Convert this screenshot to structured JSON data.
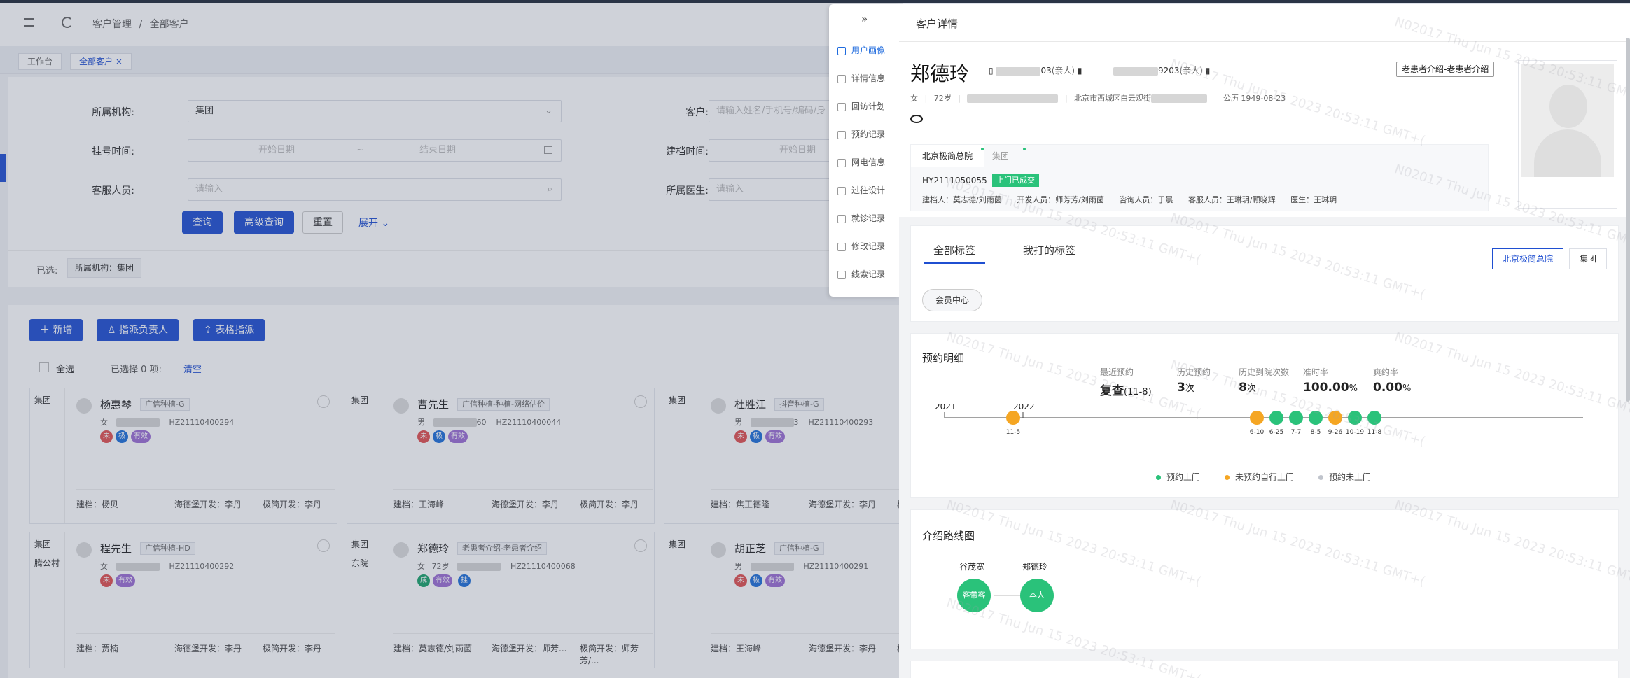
{
  "topbar": {
    "breadcrumb_1": "客户管理",
    "breadcrumb_sep": "/",
    "breadcrumb_2": "全部客户"
  },
  "tabs": [
    {
      "label": "工作台"
    },
    {
      "label": "全部客户",
      "close": "×"
    }
  ],
  "filter": {
    "org_label": "所属机构:",
    "org_value": "集团",
    "customer_label": "客户:",
    "customer_placeholder": "请输入姓名/手机号/编码/身",
    "reg_time_label": "挂号时间:",
    "start_placeholder": "开始日期",
    "range_sep": "~",
    "end_placeholder": "结束日期",
    "archive_time_label": "建档时间:",
    "archive_start_placeholder": "开始日期",
    "service_label": "客服人员:",
    "service_placeholder": "请输入",
    "doctor_label": "所属医生:",
    "doctor_placeholder": "请输入",
    "query": "查询",
    "advanced": "高级查询",
    "reset": "重置",
    "expand": "展开",
    "selected_label": "已选:",
    "selected_chip": "所属机构：集团"
  },
  "toolbar": {
    "add": "新增",
    "assign": "指派负责人",
    "table_assign": "表格指派",
    "select_all": "全选",
    "selected_count": "已选择 0 项:",
    "clear": "清空"
  },
  "cards": [
    {
      "tag": "集团",
      "sub": "",
      "name": "杨惠琴",
      "source": "广信种植-G",
      "gender": "女",
      "code": "HZ21110400294",
      "tags": [
        "未",
        "极",
        "有效"
      ],
      "f1": "建档：杨贝",
      "f2": "海德堡开发：李丹",
      "f3": "极简开发：李丹"
    },
    {
      "tag": "集团",
      "sub": "",
      "name": "曹先生",
      "source": "广信种植-种植-网络估价",
      "gender": "男",
      "phone_tail": "60",
      "code": "HZ21110400044",
      "tags": [
        "未",
        "极",
        "有效"
      ],
      "f1": "建档：王海峰",
      "f2": "海德堡开发：李丹",
      "f3": "极简开发：李丹"
    },
    {
      "tag": "集团",
      "sub": "",
      "name": "杜胜江",
      "source": "抖音种植-G",
      "gender": "男",
      "phone_tail": "3",
      "code": "HZ21110400293",
      "tags": [
        "未",
        "极",
        "有效"
      ],
      "f1": "建档：焦王德隆",
      "f2": "海德堡开发：李丹",
      "f3": "极"
    },
    {
      "tag": "集团",
      "sub": "腾公村",
      "name": "程先生",
      "source": "广信种植-HD",
      "gender": "女",
      "code": "HZ21110400292",
      "tags": [
        "未",
        "有效"
      ],
      "f1": "建档：贾楠",
      "f2": "海德堡开发：李丹",
      "f3": "极简开发：李丹"
    },
    {
      "tag": "集团",
      "sub": "东院",
      "name": "郑德玲",
      "source": "老患者介绍-老患者介绍",
      "gender": "女",
      "age": "72岁",
      "code": "HZ21110400068",
      "tags": [
        "成",
        "有效",
        "挂"
      ],
      "f1": "建档：莫志德/刘雨菌",
      "f2": "海德堡开发：师芳...",
      "f3": "极简开发：师芳芳/..."
    },
    {
      "tag": "集团",
      "sub": "",
      "name": "胡正芝",
      "source": "广信种植-G",
      "gender": "男",
      "code": "HZ21110400291",
      "tags": [
        "未",
        "极",
        "有效"
      ],
      "f1": "建档：王海峰",
      "f2": "海德堡开发：李丹",
      "f3": "极"
    }
  ],
  "sidenav": {
    "collapse": "»",
    "items": [
      {
        "label": "用户画像"
      },
      {
        "label": "详情信息"
      },
      {
        "label": "回访计划"
      },
      {
        "label": "预约记录"
      },
      {
        "label": "网电信息"
      },
      {
        "label": "过往设计"
      },
      {
        "label": "就诊记录"
      },
      {
        "label": "修改记录"
      },
      {
        "label": "线索记录"
      }
    ]
  },
  "panel": {
    "title": "客户详情",
    "name": "郑德玲",
    "phone1_tail": "03",
    "phone1_rel": "(亲人)",
    "phone2_tail": "9203",
    "phone2_rel": "(亲人)",
    "source_chip": "老患者介绍-老患者介绍",
    "gender": "女",
    "age": "72岁",
    "address": "北京市西城区白云观街",
    "birthday": "公历 1949-08-23",
    "org_tabs": [
      "北京极简总院",
      "集团"
    ],
    "record_code": "HY2111050055",
    "status": "上门已成交",
    "roles": {
      "archive": "建档人：莫志德/刘雨菌",
      "dev": "开发人员：师芳芳/刘雨菌",
      "consult": "咨询人员：于晨",
      "service": "客服人员：王琳玥/顾晓辉",
      "doctor": "医生：王琳玥"
    },
    "tag_tabs": [
      "全部标签",
      "我打的标签"
    ],
    "tag_seg": [
      "北京极简总院",
      "集团"
    ],
    "tag_chip": "会员中心",
    "appointment": {
      "title": "预约明细",
      "stats": [
        {
          "label": "最近预约",
          "value": "复查",
          "unit": "(11-8)"
        },
        {
          "label": "历史预约",
          "value": "3",
          "unit": "次"
        },
        {
          "label": "历史到院次数",
          "value": "8",
          "unit": "次"
        },
        {
          "label": "准时率",
          "value": "100.00",
          "unit": "%"
        },
        {
          "label": "爽约率",
          "value": "0.00",
          "unit": "%"
        }
      ],
      "years": [
        "2021",
        "2022"
      ],
      "legend": [
        "预约上门",
        "未预约自行上门",
        "预约未上门"
      ]
    },
    "route": {
      "title": "介绍路线图",
      "people": [
        {
          "name": "谷茂宽",
          "role": "客带客"
        },
        {
          "name": "郑德玲",
          "role": "本人"
        }
      ]
    },
    "watermark": "N02017 Thu Jun 15 2023 20:53:11 GMT+(",
    "colors": {
      "primary": "#1f4fd1",
      "green": "#2ac27a",
      "orange": "#f5a623",
      "gray": "#c0c4cc"
    }
  },
  "chart_data": {
    "type": "scatter",
    "title": "",
    "x": [
      "11-5",
      "6-10",
      "6-25",
      "7-7",
      "8-5",
      "9-26",
      "10-19",
      "11-8"
    ],
    "series": [
      {
        "name": "预约上门",
        "points": [
          "6-25",
          "7-7",
          "8-5",
          "10-19",
          "11-8"
        ]
      },
      {
        "name": "未预约自行上门",
        "points": [
          "11-5",
          "6-10",
          "9-26"
        ]
      },
      {
        "name": "预约未上门",
        "points": []
      }
    ]
  }
}
